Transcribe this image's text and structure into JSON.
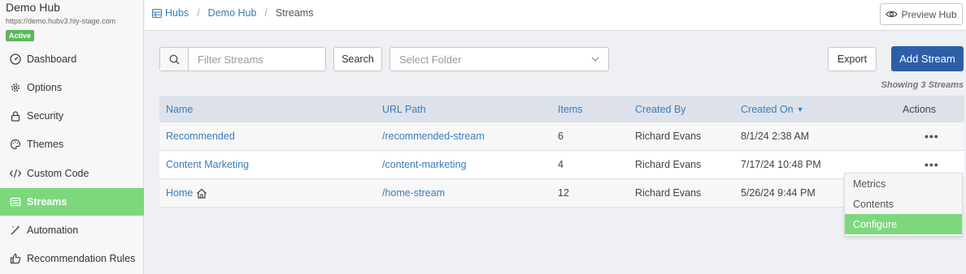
{
  "sidebar": {
    "hub_title": "Demo Hub",
    "hub_url": "https://demo.hubv3.hly-stage.com",
    "status_badge": "Active",
    "items": [
      {
        "label": "Dashboard",
        "icon": "dashboard-icon"
      },
      {
        "label": "Options",
        "icon": "gear-icon"
      },
      {
        "label": "Security",
        "icon": "lock-icon"
      },
      {
        "label": "Themes",
        "icon": "palette-icon"
      },
      {
        "label": "Custom Code",
        "icon": "code-icon"
      },
      {
        "label": "Streams",
        "icon": "streams-icon",
        "active": true
      },
      {
        "label": "Automation",
        "icon": "wand-icon"
      },
      {
        "label": "Recommendation Rules",
        "icon": "thumbs-up-icon"
      }
    ]
  },
  "breadcrumb": {
    "hubs": "Hubs",
    "hub": "Demo Hub",
    "current": "Streams"
  },
  "header": {
    "preview_label": "Preview Hub"
  },
  "toolbar": {
    "filter_placeholder": "Filter Streams",
    "search_label": "Search",
    "folder_placeholder": "Select Folder",
    "export_label": "Export",
    "add_label": "Add Stream",
    "showing_text": "Showing 3 Streams"
  },
  "table": {
    "columns": {
      "name": "Name",
      "url": "URL Path",
      "items": "Items",
      "created_by": "Created By",
      "created_on": "Created On",
      "actions": "Actions"
    },
    "sort_indicator": "▼",
    "rows": [
      {
        "name": "Recommended",
        "url": "/recommended-stream",
        "items": "6",
        "created_by": "Richard Evans",
        "created_on": "8/1/24 2:38 AM",
        "actions": "•••"
      },
      {
        "name": "Content Marketing",
        "url": "/content-marketing",
        "items": "4",
        "created_by": "Richard Evans",
        "created_on": "7/17/24 10:48 PM",
        "actions": "•••"
      },
      {
        "name": "Home",
        "url": "/home-stream",
        "items": "12",
        "created_by": "Richard Evans",
        "created_on": "5/26/24 9:44 PM",
        "home_icon": "home-icon"
      }
    ]
  },
  "action_menu": {
    "items": [
      "Metrics",
      "Contents",
      "Configure"
    ],
    "active": "Configure"
  },
  "colors": {
    "accent_green": "#7dd87d",
    "primary_blue": "#2d5ea8",
    "link_blue": "#3a7bbf"
  }
}
